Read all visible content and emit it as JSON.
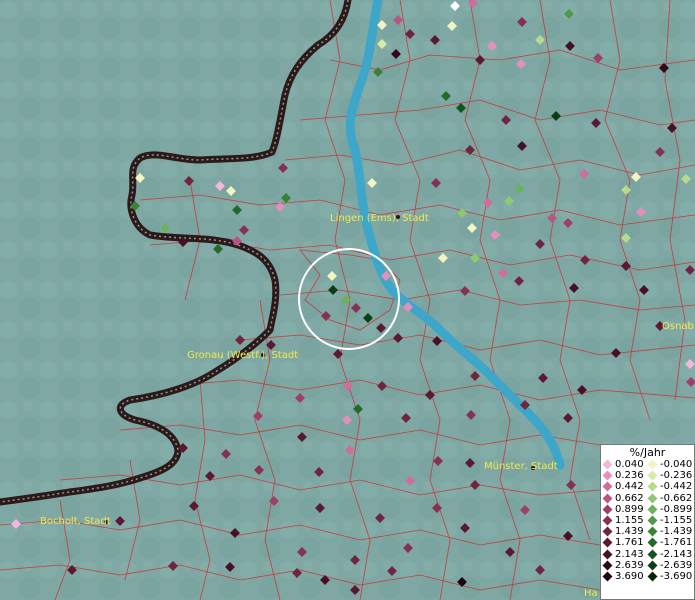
{
  "legend": {
    "title": "%/Jahr",
    "positive": [
      {
        "label": "0.040",
        "color": "#f4b6dc"
      },
      {
        "label": "0.236",
        "color": "#e58fbd"
      },
      {
        "label": "0.442",
        "color": "#cf6e9c"
      },
      {
        "label": "0.662",
        "color": "#b85582"
      },
      {
        "label": "0.899",
        "color": "#9d3f68"
      },
      {
        "label": "1.155",
        "color": "#853152"
      },
      {
        "label": "1.439",
        "color": "#6f2440"
      },
      {
        "label": "1.761",
        "color": "#5a1931"
      },
      {
        "label": "2.143",
        "color": "#461025"
      },
      {
        "label": "2.639",
        "color": "#33081a"
      },
      {
        "label": "3.690",
        "color": "#1e0410"
      }
    ],
    "negative": [
      {
        "label": "-0.040",
        "color": "#f2f5c2"
      },
      {
        "label": "-0.236",
        "color": "#d7eba8"
      },
      {
        "label": "-0.442",
        "color": "#b4db8e"
      },
      {
        "label": "-0.662",
        "color": "#8fc775"
      },
      {
        "label": "-0.899",
        "color": "#6bb25f"
      },
      {
        "label": "-1.155",
        "color": "#4e9a4a"
      },
      {
        "label": "-1.439",
        "color": "#37833a"
      },
      {
        "label": "-1.761",
        "color": "#236b2b"
      },
      {
        "label": "-2.143",
        "color": "#14541f"
      },
      {
        "label": "-2.639",
        "color": "#0b3e15"
      },
      {
        "label": "-3.690",
        "color": "#05260b"
      }
    ]
  },
  "places": [
    {
      "name": "Lingen (Ems), Stadt"
    },
    {
      "name": "Gronau (Westf.), Stadt"
    },
    {
      "name": "Münster, Stadt"
    },
    {
      "name": "Bocholt, Stadt"
    },
    {
      "name": "Osnab"
    },
    {
      "name": "Ha"
    }
  ],
  "colors": {
    "background": "#7fa8a4",
    "river": "#3ea6c8",
    "border": "#2a1a1a",
    "municipal_lines": "#d12a2a",
    "city_label": "#f2e94e",
    "highlight_ring": "#ffffff"
  }
}
